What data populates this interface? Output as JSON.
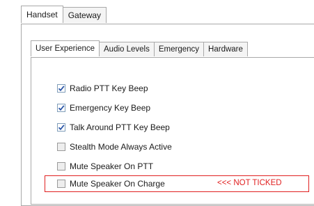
{
  "outer_tabs": [
    {
      "label": "Handset",
      "active": true
    },
    {
      "label": "Gateway",
      "active": false
    }
  ],
  "inner_tabs": [
    {
      "label": "User Experience",
      "active": true
    },
    {
      "label": "Audio Levels",
      "active": false
    },
    {
      "label": "Emergency",
      "active": false
    },
    {
      "label": "Hardware",
      "active": false
    }
  ],
  "options": [
    {
      "label": "Radio PTT Key Beep",
      "checked": true
    },
    {
      "label": "Emergency Key Beep",
      "checked": true
    },
    {
      "label": "Talk Around PTT Key Beep",
      "checked": true
    },
    {
      "label": "Stealth Mode Always Active",
      "checked": false
    },
    {
      "label": "Mute Speaker On PTT",
      "checked": false
    },
    {
      "label": "Mute Speaker On Charge",
      "checked": false
    }
  ],
  "annotation": {
    "text": "<<< NOT TICKED",
    "color": "#e02020"
  },
  "colors": {
    "check": "#2a55a8",
    "border": "#a9a9a9"
  }
}
